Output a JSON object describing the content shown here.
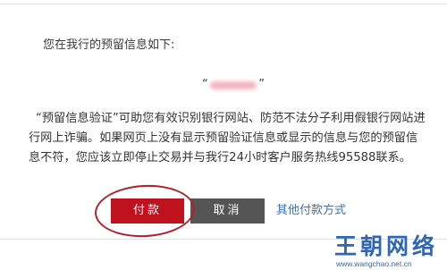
{
  "dialog": {
    "intro_text": "您在我行的预留信息如下:",
    "reserved_info": {
      "open_quote": "“",
      "close_quote": "”",
      "value_obscured": true
    },
    "description": "“预留信息验证”可助您有效识别银行网站、防范不法分子利用假银行网站进行网上诈骗。如果网页上没有显示预留验证信息或显示的信息与您的预留信息不符，您应该立即停止交易并与我行24小时客户服务热线95588联系。"
  },
  "actions": {
    "pay_label": "付款",
    "cancel_label": "取消",
    "other_methods_label": "其他付款方式"
  },
  "annotation": {
    "highlight": "pay-button",
    "color": "#b3202a"
  },
  "watermark": {
    "logo_text": "王朝网络",
    "url": "www.wangchao.net.cn"
  },
  "colors": {
    "pay_button": "#c0111f",
    "cancel_button": "#555555",
    "link": "#3d6fb6",
    "watermark": "#2f66b3"
  }
}
